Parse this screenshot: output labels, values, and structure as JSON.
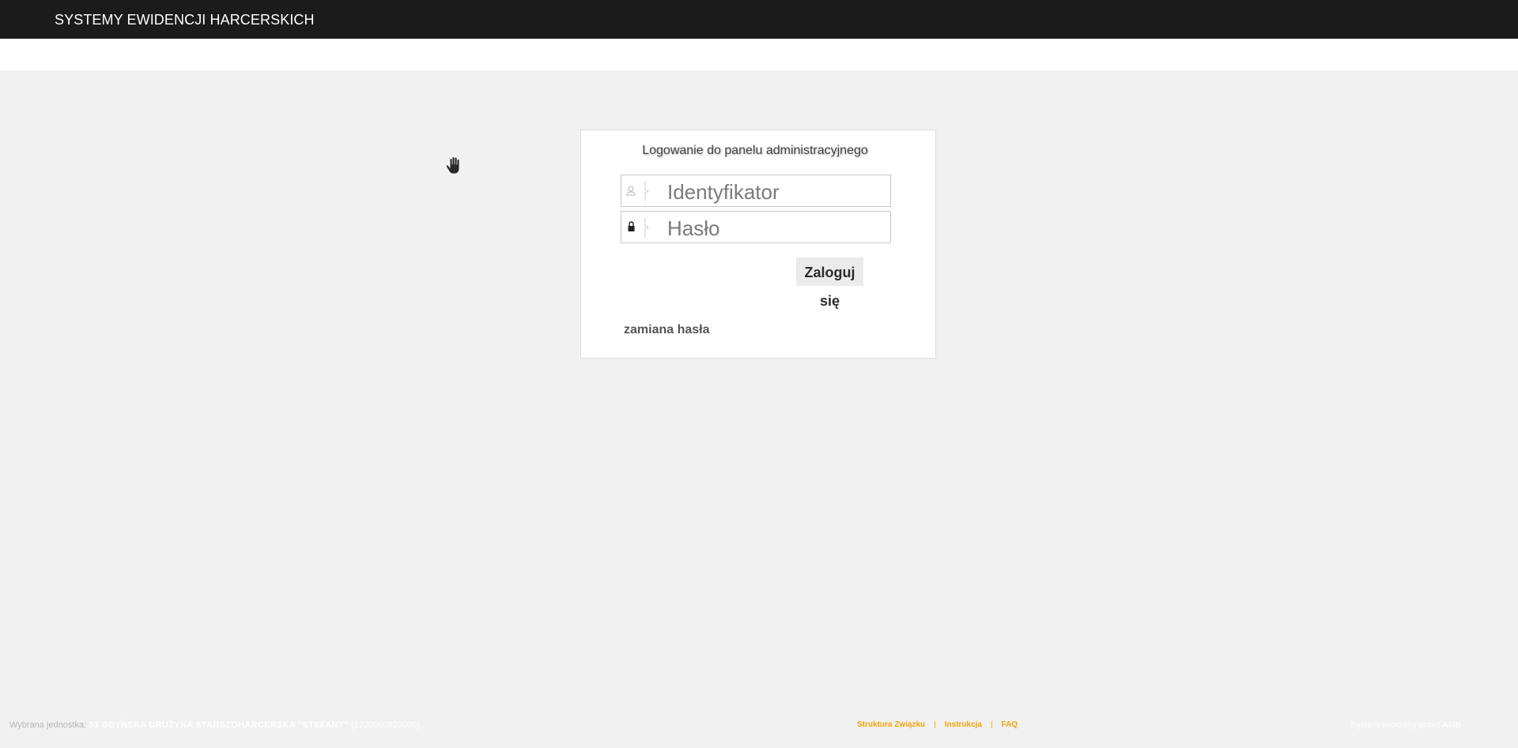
{
  "header": {
    "app_title": "SYSTEMY EWIDENCJI HARCERSKICH"
  },
  "login": {
    "title": "Logowanie do panelu administracyjnego",
    "username_placeholder": "Identyfikator",
    "password_placeholder": "Hasło",
    "submit_label": "Zaloguj się",
    "change_password_label": "zamiana hasła",
    "username_icon": "user-icon",
    "password_icon": "lock-icon"
  },
  "cursor": {
    "icon": "hand-icon"
  },
  "footer": {
    "selected_unit_label": "Wybrana jednostka:",
    "selected_unit_name": "53 GDYŃSKA DRUŻYNA STARSZOHARCERSKA \"STEFANY\"",
    "selected_unit_code": "(1220060520000)",
    "links": [
      "Struktura Związku",
      "Instrukcja",
      "FAQ"
    ],
    "link_separator": "|",
    "right_text": "System tworzony przez AMB"
  },
  "colors": {
    "topbar": "#1b1b1b",
    "background": "#f1f1f1",
    "link_accent": "#f2a20c"
  }
}
